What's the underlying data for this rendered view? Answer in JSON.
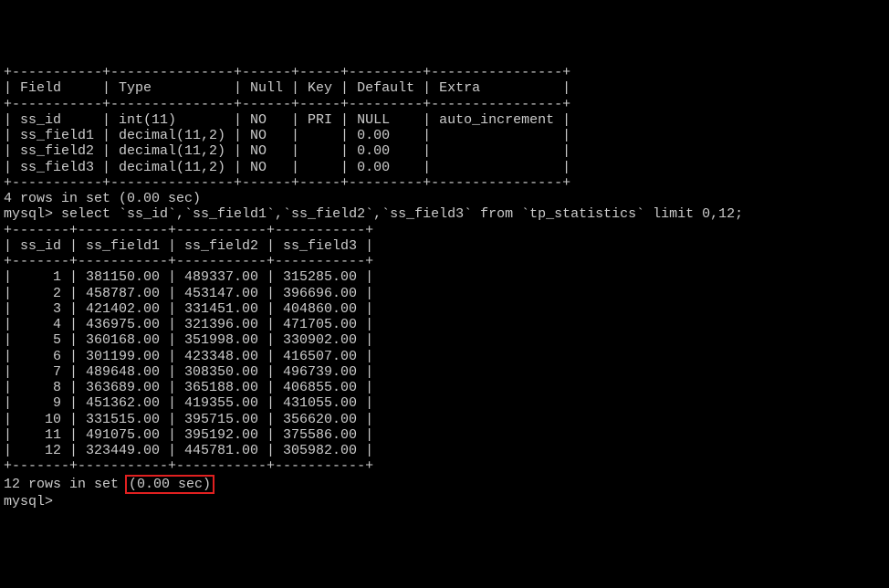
{
  "describe_table": {
    "border_top": "+-----------+---------------+------+-----+---------+----------------+",
    "header_line": "| Field     | Type          | Null | Key | Default | Extra          |",
    "border_mid": "+-----------+---------------+------+-----+---------+----------------+",
    "rows": [
      "| ss_id     | int(11)       | NO   | PRI | NULL    | auto_increment |",
      "| ss_field1 | decimal(11,2) | NO   |     | 0.00    |                |",
      "| ss_field2 | decimal(11,2) | NO   |     | 0.00    |                |",
      "| ss_field3 | decimal(11,2) | NO   |     | 0.00    |                |"
    ],
    "border_bot": "+-----------+---------------+------+-----+---------+----------------+",
    "summary": "4 rows in set (0.00 sec)"
  },
  "query": {
    "prompt": "mysql> ",
    "sql": "select `ss_id`,`ss_field1`,`ss_field2`,`ss_field3` from `tp_statistics` limit 0,12;"
  },
  "result_table": {
    "border_top": "+-------+-----------+-----------+-----------+",
    "header_line": "| ss_id | ss_field1 | ss_field2 | ss_field3 |",
    "border_mid": "+-------+-----------+-----------+-----------+",
    "rows": [
      "|     1 | 381150.00 | 489337.00 | 315285.00 |",
      "|     2 | 458787.00 | 453147.00 | 396696.00 |",
      "|     3 | 421402.00 | 331451.00 | 404860.00 |",
      "|     4 | 436975.00 | 321396.00 | 471705.00 |",
      "|     5 | 360168.00 | 351998.00 | 330902.00 |",
      "|     6 | 301199.00 | 423348.00 | 416507.00 |",
      "|     7 | 489648.00 | 308350.00 | 496739.00 |",
      "|     8 | 363689.00 | 365188.00 | 406855.00 |",
      "|     9 | 451362.00 | 419355.00 | 431055.00 |",
      "|    10 | 331515.00 | 395715.00 | 356620.00 |",
      "|    11 | 491075.00 | 395192.00 | 375586.00 |",
      "|    12 | 323449.00 | 445781.00 | 305982.00 |"
    ],
    "border_bot": "+-------+-----------+-----------+-----------+",
    "summary_prefix": "12 rows in set ",
    "summary_highlight": "(0.00 sec)"
  },
  "final_prompt": "mysql> ",
  "chart_data": {
    "type": "table",
    "describe": {
      "columns": [
        "Field",
        "Type",
        "Null",
        "Key",
        "Default",
        "Extra"
      ],
      "rows": [
        [
          "ss_id",
          "int(11)",
          "NO",
          "PRI",
          "NULL",
          "auto_increment"
        ],
        [
          "ss_field1",
          "decimal(11,2)",
          "NO",
          "",
          "0.00",
          ""
        ],
        [
          "ss_field2",
          "decimal(11,2)",
          "NO",
          "",
          "0.00",
          ""
        ],
        [
          "ss_field3",
          "decimal(11,2)",
          "NO",
          "",
          "0.00",
          ""
        ]
      ]
    },
    "select_result": {
      "columns": [
        "ss_id",
        "ss_field1",
        "ss_field2",
        "ss_field3"
      ],
      "rows": [
        [
          1,
          381150.0,
          489337.0,
          315285.0
        ],
        [
          2,
          458787.0,
          453147.0,
          396696.0
        ],
        [
          3,
          421402.0,
          331451.0,
          404860.0
        ],
        [
          4,
          436975.0,
          321396.0,
          471705.0
        ],
        [
          5,
          360168.0,
          351998.0,
          330902.0
        ],
        [
          6,
          301199.0,
          423348.0,
          416507.0
        ],
        [
          7,
          489648.0,
          308350.0,
          496739.0
        ],
        [
          8,
          363689.0,
          365188.0,
          406855.0
        ],
        [
          9,
          451362.0,
          419355.0,
          431055.0
        ],
        [
          10,
          331515.0,
          395715.0,
          356620.0
        ],
        [
          11,
          491075.0,
          395192.0,
          375586.0
        ],
        [
          12,
          323449.0,
          445781.0,
          305982.0
        ]
      ]
    }
  }
}
